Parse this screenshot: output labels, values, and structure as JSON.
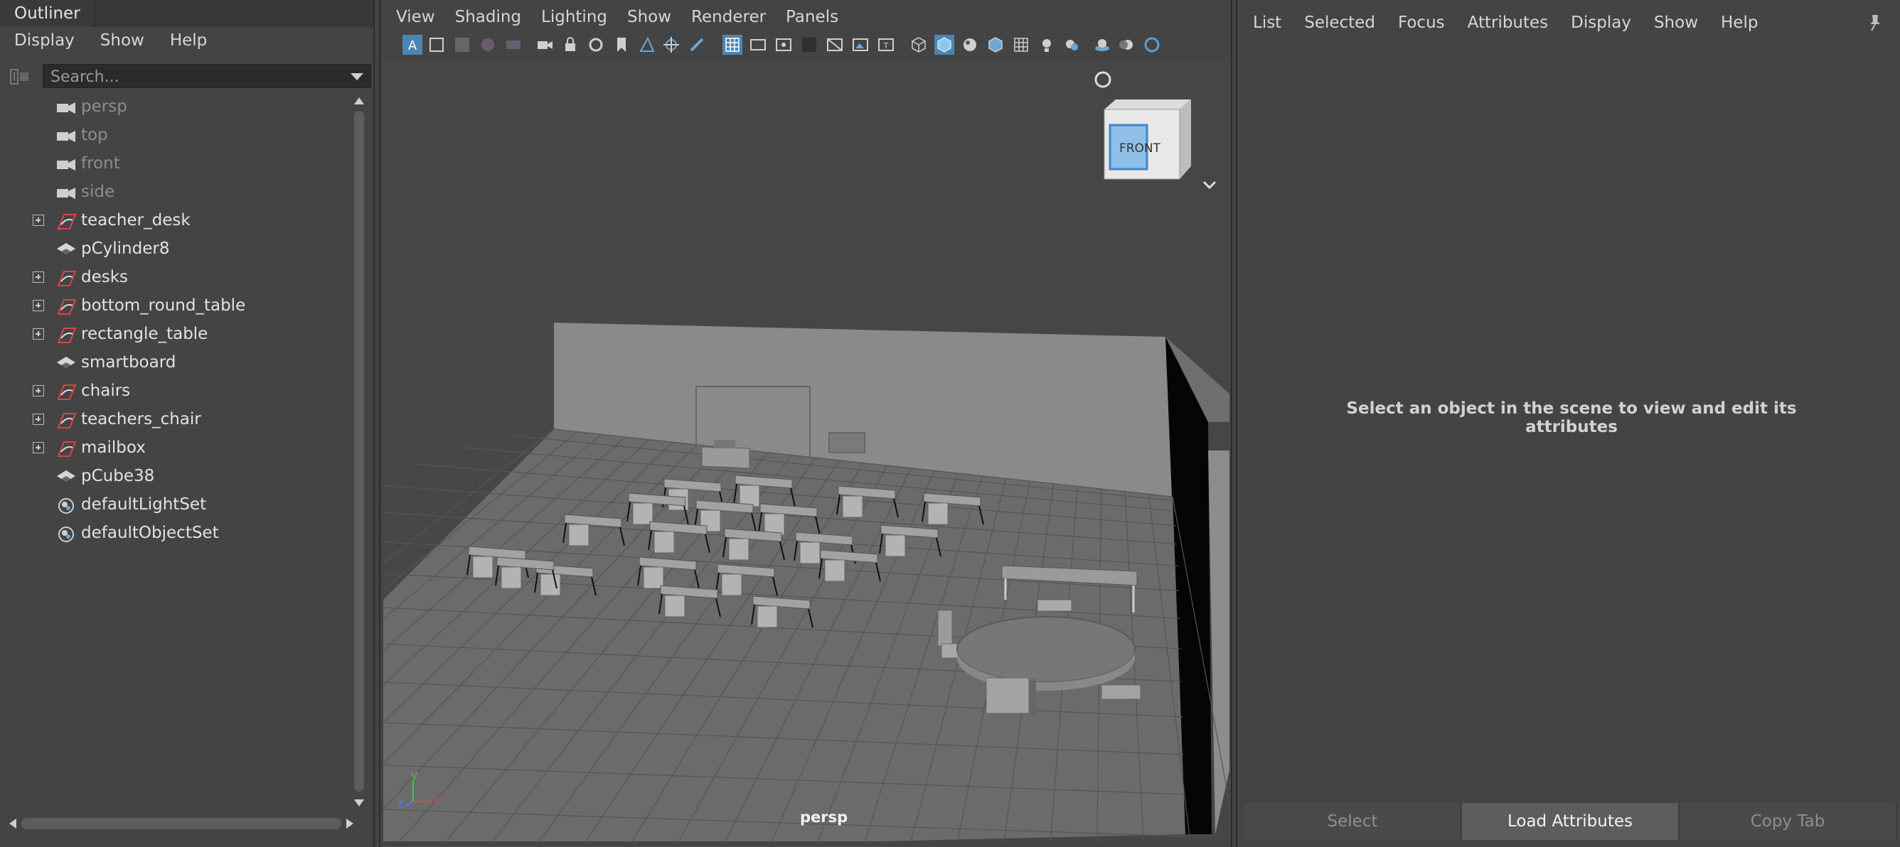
{
  "outliner": {
    "title": "Outliner",
    "menu": [
      "Display",
      "Show",
      "Help"
    ],
    "search_placeholder": "Search...",
    "items": [
      {
        "label": "persp",
        "type": "camera",
        "expandable": false,
        "dim": true
      },
      {
        "label": "top",
        "type": "camera",
        "expandable": false,
        "dim": true
      },
      {
        "label": "front",
        "type": "camera",
        "expandable": false,
        "dim": true
      },
      {
        "label": "side",
        "type": "camera",
        "expandable": false,
        "dim": true
      },
      {
        "label": "teacher_desk",
        "type": "group",
        "expandable": true,
        "dim": false
      },
      {
        "label": "pCylinder8",
        "type": "mesh",
        "expandable": false,
        "dim": false
      },
      {
        "label": "desks",
        "type": "group",
        "expandable": true,
        "dim": false
      },
      {
        "label": "bottom_round_table",
        "type": "group",
        "expandable": true,
        "dim": false
      },
      {
        "label": "rectangle_table",
        "type": "group",
        "expandable": true,
        "dim": false
      },
      {
        "label": "smartboard",
        "type": "mesh",
        "expandable": false,
        "dim": false
      },
      {
        "label": "chairs",
        "type": "group",
        "expandable": true,
        "dim": false
      },
      {
        "label": "teachers_chair",
        "type": "group",
        "expandable": true,
        "dim": false
      },
      {
        "label": "mailbox",
        "type": "group",
        "expandable": true,
        "dim": false
      },
      {
        "label": "pCube38",
        "type": "mesh",
        "expandable": false,
        "dim": false
      },
      {
        "label": "defaultLightSet",
        "type": "set",
        "expandable": false,
        "dim": false
      },
      {
        "label": "defaultObjectSet",
        "type": "set",
        "expandable": false,
        "dim": false
      }
    ]
  },
  "viewport": {
    "menu": [
      "View",
      "Shading",
      "Lighting",
      "Show",
      "Renderer",
      "Panels"
    ],
    "camera_label": "persp",
    "viewcube_face": "FRONT",
    "axis": {
      "y": "y",
      "z": "z",
      "x": "x"
    },
    "colors": {
      "accent": "#5aa0d6",
      "toolbar_active": "#4c86b3"
    }
  },
  "attribute_editor": {
    "menu": [
      "List",
      "Selected",
      "Focus",
      "Attributes",
      "Display",
      "Show",
      "Help"
    ],
    "message": "Select an object in the scene to view and edit its attributes",
    "buttons": [
      {
        "label": "Select",
        "active": false
      },
      {
        "label": "Load Attributes",
        "active": true
      },
      {
        "label": "Copy Tab",
        "active": false
      }
    ]
  }
}
